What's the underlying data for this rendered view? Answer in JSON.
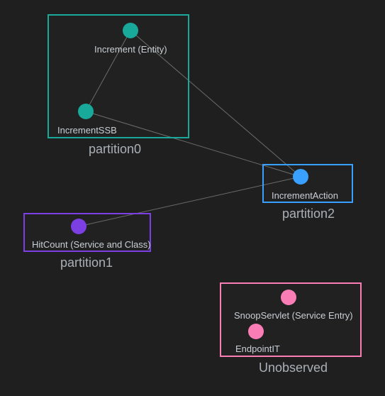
{
  "partitions": {
    "p0": {
      "label": "partition0",
      "color": "#19a99b"
    },
    "p2": {
      "label": "partition2",
      "color": "#3aa0ff"
    },
    "p1": {
      "label": "partition1",
      "color": "#7b3fe4"
    },
    "unobs": {
      "label": "Unobserved",
      "color": "#fb7db5"
    }
  },
  "nodes": {
    "increment": {
      "label": "Increment (Entity)",
      "color": "#19a99b",
      "partition": "p0"
    },
    "incrementSSB": {
      "label": "IncrementSSB",
      "color": "#19a99b",
      "partition": "p0"
    },
    "incrementAction": {
      "label": "IncrementAction",
      "color": "#3aa0ff",
      "partition": "p2"
    },
    "hitCount": {
      "label": "HitCount (Service and Class)",
      "color": "#7b3fe4",
      "partition": "p1"
    },
    "snoopServlet": {
      "label": "SnoopServlet (Service Entry)",
      "color": "#fb7db5",
      "partition": "unobs"
    },
    "endpointIT": {
      "label": "EndpointIT",
      "color": "#fb7db5",
      "partition": "unobs"
    }
  },
  "edges": [
    {
      "from": "increment",
      "to": "incrementSSB"
    },
    {
      "from": "increment",
      "to": "incrementAction"
    },
    {
      "from": "incrementSSB",
      "to": "incrementAction"
    },
    {
      "from": "hitCount",
      "to": "incrementAction"
    }
  ]
}
